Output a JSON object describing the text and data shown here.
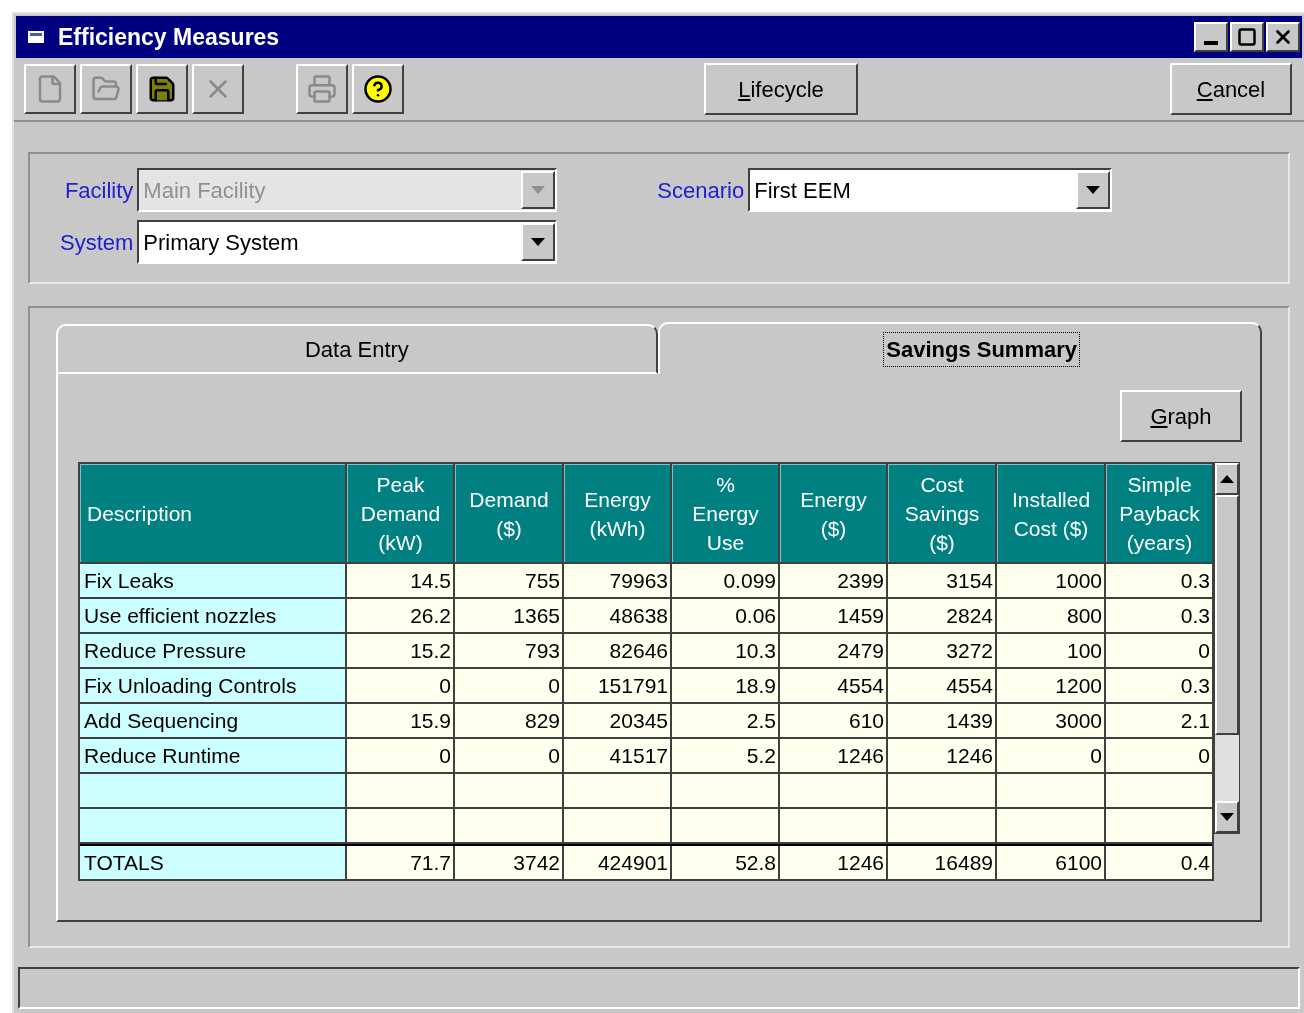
{
  "window": {
    "title": "Efficiency Measures"
  },
  "toolbar": {
    "tools": [
      {
        "kind": "new",
        "disabled": true
      },
      {
        "kind": "open",
        "disabled": true
      },
      {
        "kind": "save",
        "disabled": false
      },
      {
        "kind": "delete",
        "disabled": true
      },
      {
        "kind": "print",
        "disabled": true
      },
      {
        "kind": "help",
        "disabled": false
      }
    ],
    "buttons": [
      {
        "label": "Lifecycle",
        "underline_first": true
      },
      {
        "label": "Cancel",
        "underline_first": true
      }
    ]
  },
  "selectors": [
    {
      "label": "Facility",
      "value": "Main Facility",
      "disabled": true
    },
    {
      "label": "System",
      "value": "Primary System",
      "disabled": false
    },
    {
      "label": "Scenario",
      "value": "First EEM",
      "disabled": false
    }
  ],
  "tabs": [
    {
      "label": "Data Entry",
      "selected": false
    },
    {
      "label": "Savings Summary",
      "selected": true
    }
  ],
  "graph_button": {
    "label": "Graph",
    "underline_first": true
  },
  "table": {
    "columns": [
      "Description",
      "Peak\nDemand\n(kW)",
      "Demand\n($)",
      "Energy\n(kWh)",
      "%\nEnergy\nUse",
      "Energy\n($)",
      "Cost\nSavings\n($)",
      "Installed\nCost ($)",
      "Simple\nPayback\n(years)"
    ],
    "rows": [
      {
        "kind": "data",
        "description": "Fix Leaks",
        "values": [
          "14.5",
          "755",
          "79963",
          "0.099",
          "2399",
          "3154",
          "1000",
          "0.3"
        ]
      },
      {
        "kind": "data",
        "description": "Use efficient nozzles",
        "values": [
          "26.2",
          "1365",
          "48638",
          "0.06",
          "1459",
          "2824",
          "800",
          "0.3"
        ]
      },
      {
        "kind": "data",
        "description": "Reduce Pressure",
        "values": [
          "15.2",
          "793",
          "82646",
          "10.3",
          "2479",
          "3272",
          "100",
          "0"
        ]
      },
      {
        "kind": "data",
        "description": "Fix Unloading Controls",
        "values": [
          "0",
          "0",
          "151791",
          "18.9",
          "4554",
          "4554",
          "1200",
          "0.3"
        ]
      },
      {
        "kind": "data",
        "description": "Add Sequencing",
        "values": [
          "15.9",
          "829",
          "20345",
          "2.5",
          "610",
          "1439",
          "3000",
          "2.1"
        ]
      },
      {
        "kind": "data",
        "description": "Reduce Runtime",
        "values": [
          "0",
          "0",
          "41517",
          "5.2",
          "1246",
          "1246",
          "0",
          "0"
        ]
      },
      {
        "kind": "empty"
      },
      {
        "kind": "empty"
      }
    ],
    "totals": {
      "description": "TOTALS",
      "values": [
        "71.7",
        "3742",
        "424901",
        "52.8",
        "1246",
        "16489",
        "6100",
        "0.4"
      ]
    }
  }
}
